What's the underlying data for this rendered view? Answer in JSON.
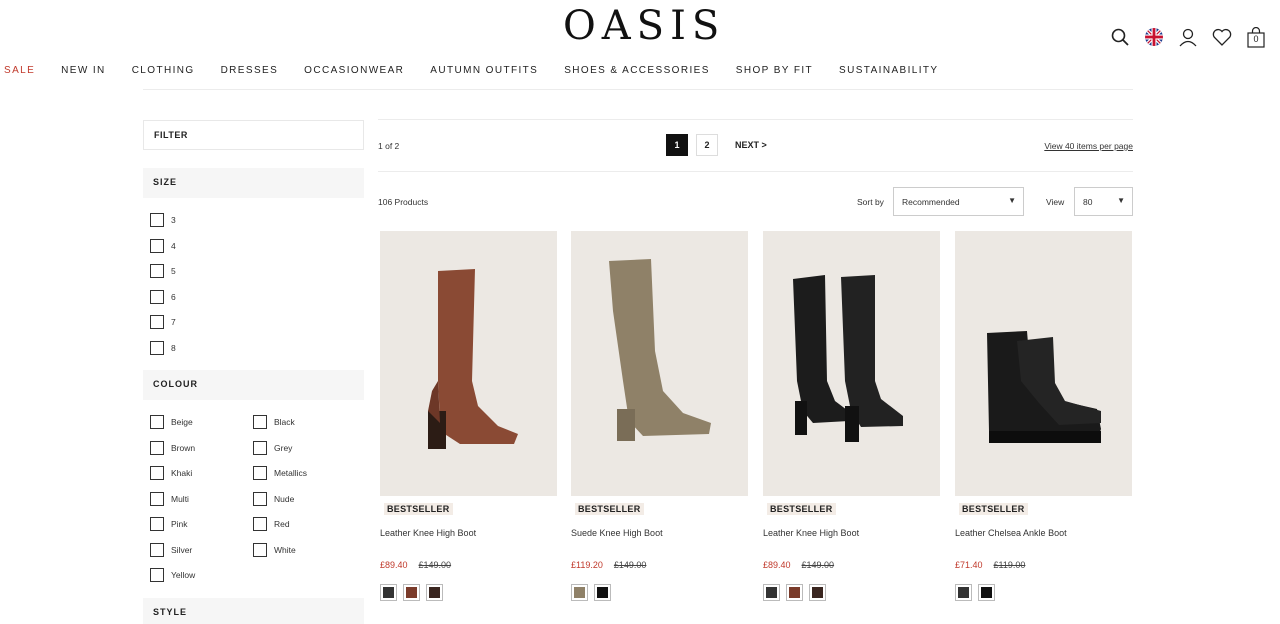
{
  "brand": "OASIS",
  "header": {
    "basket_count": "0"
  },
  "nav": [
    "SALE",
    "NEW IN",
    "CLOTHING",
    "DRESSES",
    "OCCASIONWEAR",
    "AUTUMN OUTFITS",
    "SHOES & ACCESSORIES",
    "SHOP BY FIT",
    "SUSTAINABILITY"
  ],
  "filter": {
    "title": "FILTER",
    "size": {
      "title": "SIZE",
      "options": [
        "3",
        "4",
        "5",
        "6",
        "7",
        "8"
      ]
    },
    "colour": {
      "title": "COLOUR",
      "left": [
        "Beige",
        "Brown",
        "Khaki",
        "Multi",
        "Pink",
        "Silver",
        "Yellow"
      ],
      "right": [
        "Black",
        "Grey",
        "Metallics",
        "Nude",
        "Red",
        "White"
      ]
    },
    "style": {
      "title": "STYLE"
    }
  },
  "pagination": {
    "status": "1 of 2",
    "pages": [
      "1",
      "2"
    ],
    "next": "NEXT >",
    "view_per_page": "View 40 items per page"
  },
  "listing": {
    "count": "106 Products",
    "sort_label": "Sort by",
    "sort_value": "Recommended",
    "view_label": "View",
    "view_value": "80"
  },
  "products": [
    {
      "badge": "BESTSELLER",
      "name": "Leather Knee High Boot",
      "price": "£89.40",
      "was": "£149.00",
      "swatches": [
        "#333333",
        "#7a3b2a",
        "#3a2620"
      ]
    },
    {
      "badge": "BESTSELLER",
      "name": "Suede Knee High Boot",
      "price": "£119.20",
      "was": "£149.00",
      "swatches": [
        "#8f8168",
        "#111111"
      ]
    },
    {
      "badge": "BESTSELLER",
      "name": "Leather Knee High Boot",
      "price": "£89.40",
      "was": "£149.00",
      "swatches": [
        "#333333",
        "#7a3b2a",
        "#3a2620"
      ]
    },
    {
      "badge": "BESTSELLER",
      "name": "Leather Chelsea Ankle Boot",
      "price": "£71.40",
      "was": "£119.00",
      "swatches": [
        "#333333",
        "#111111"
      ]
    }
  ],
  "colors": {
    "sale_red": "#c0392b",
    "image_bg": "#ece8e3"
  }
}
